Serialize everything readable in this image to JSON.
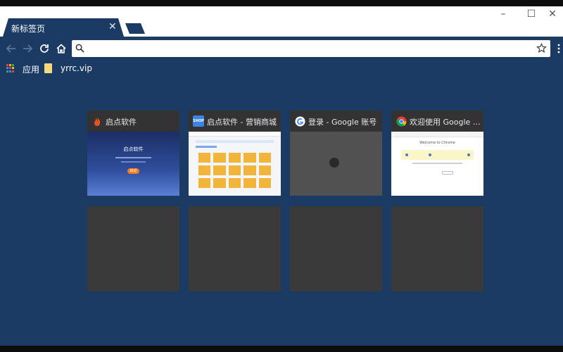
{
  "window": {
    "minimize": "–",
    "maximize": "☐",
    "close": "✕"
  },
  "tab": {
    "title": "新标签页",
    "close": "✕"
  },
  "toolbar": {
    "address_value": ""
  },
  "bookmarks": {
    "apps_label": "应用",
    "folder_label": "yrrc.vip"
  },
  "tiles": [
    {
      "title": "启点软件",
      "favicon": "flame-icon",
      "thumb_heading": "启点软件",
      "thumb_button": "启动"
    },
    {
      "title": "启点软件 - 营销商城",
      "favicon": "shop-logo-icon",
      "favicon_text": "SHOP"
    },
    {
      "title": "登录 - Google 账号",
      "favicon": "google-g-icon"
    },
    {
      "title": "欢迎使用 Google C...",
      "favicon": "chrome-icon",
      "thumb_heading": "Welcome to Chrome"
    }
  ],
  "colors": {
    "background": "#1b3a64",
    "tile": "#3a3a3a",
    "tile_header": "#333333",
    "titlebar": "#ffffff"
  }
}
